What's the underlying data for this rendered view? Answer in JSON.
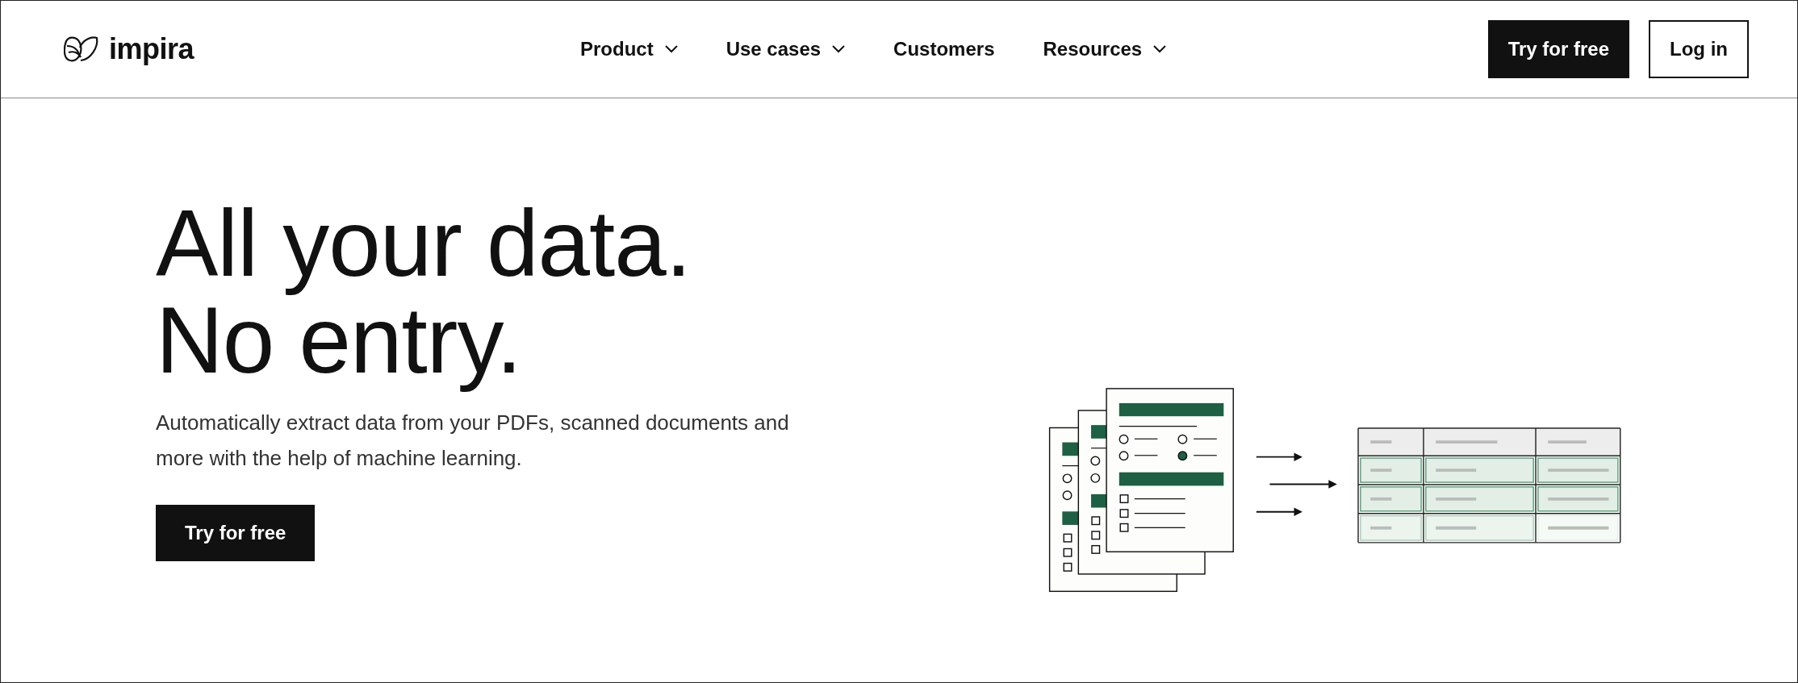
{
  "header": {
    "logo_text": "impira",
    "nav": [
      {
        "label": "Product",
        "kind": "dropdown"
      },
      {
        "label": "Use cases",
        "kind": "dropdown"
      },
      {
        "label": "Customers",
        "kind": "link"
      },
      {
        "label": "Resources",
        "kind": "dropdown"
      }
    ],
    "buttons": [
      {
        "label": "Try for free",
        "kind": "primary"
      },
      {
        "label": "Log in",
        "kind": "secondary"
      }
    ]
  },
  "hero": {
    "headline": [
      "All your data.",
      "No entry."
    ],
    "description": "Automatically extract data from your PDFs, scanned documents and more with the help of machine learning.",
    "button": {
      "label": "Try for free",
      "kind": "primary"
    }
  }
}
